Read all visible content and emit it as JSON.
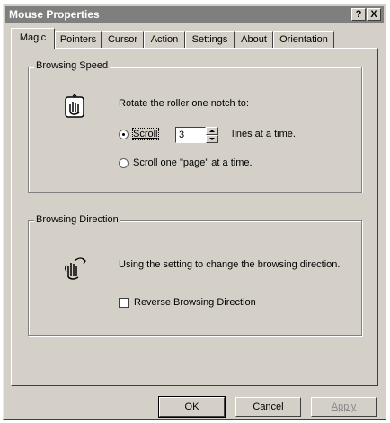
{
  "window": {
    "title": "Mouse Properties"
  },
  "titlebar_buttons": {
    "help": "?",
    "close": "X"
  },
  "tabs": [
    {
      "label": "Magic"
    },
    {
      "label": "Pointers"
    },
    {
      "label": "Cursor"
    },
    {
      "label": "Action"
    },
    {
      "label": "Settings"
    },
    {
      "label": "About"
    },
    {
      "label": "Orientation"
    }
  ],
  "browsing_speed": {
    "legend": "Browsing Speed",
    "icon": "hand-scroll-icon",
    "prompt": "Rotate the roller one notch to:",
    "option_scroll_label": "Scroll",
    "lines_value": "3",
    "lines_suffix": "lines at a time.",
    "option_page_label": "Scroll one \"page\" at a time.",
    "selected": "Scroll"
  },
  "browsing_direction": {
    "legend": "Browsing Direction",
    "icon": "hand-direction-icon",
    "description": "Using the setting to change the browsing direction.",
    "reverse_label": "Reverse Browsing Direction",
    "reverse_checked": false
  },
  "buttons": {
    "ok": "OK",
    "cancel": "Cancel",
    "apply": "Apply"
  }
}
